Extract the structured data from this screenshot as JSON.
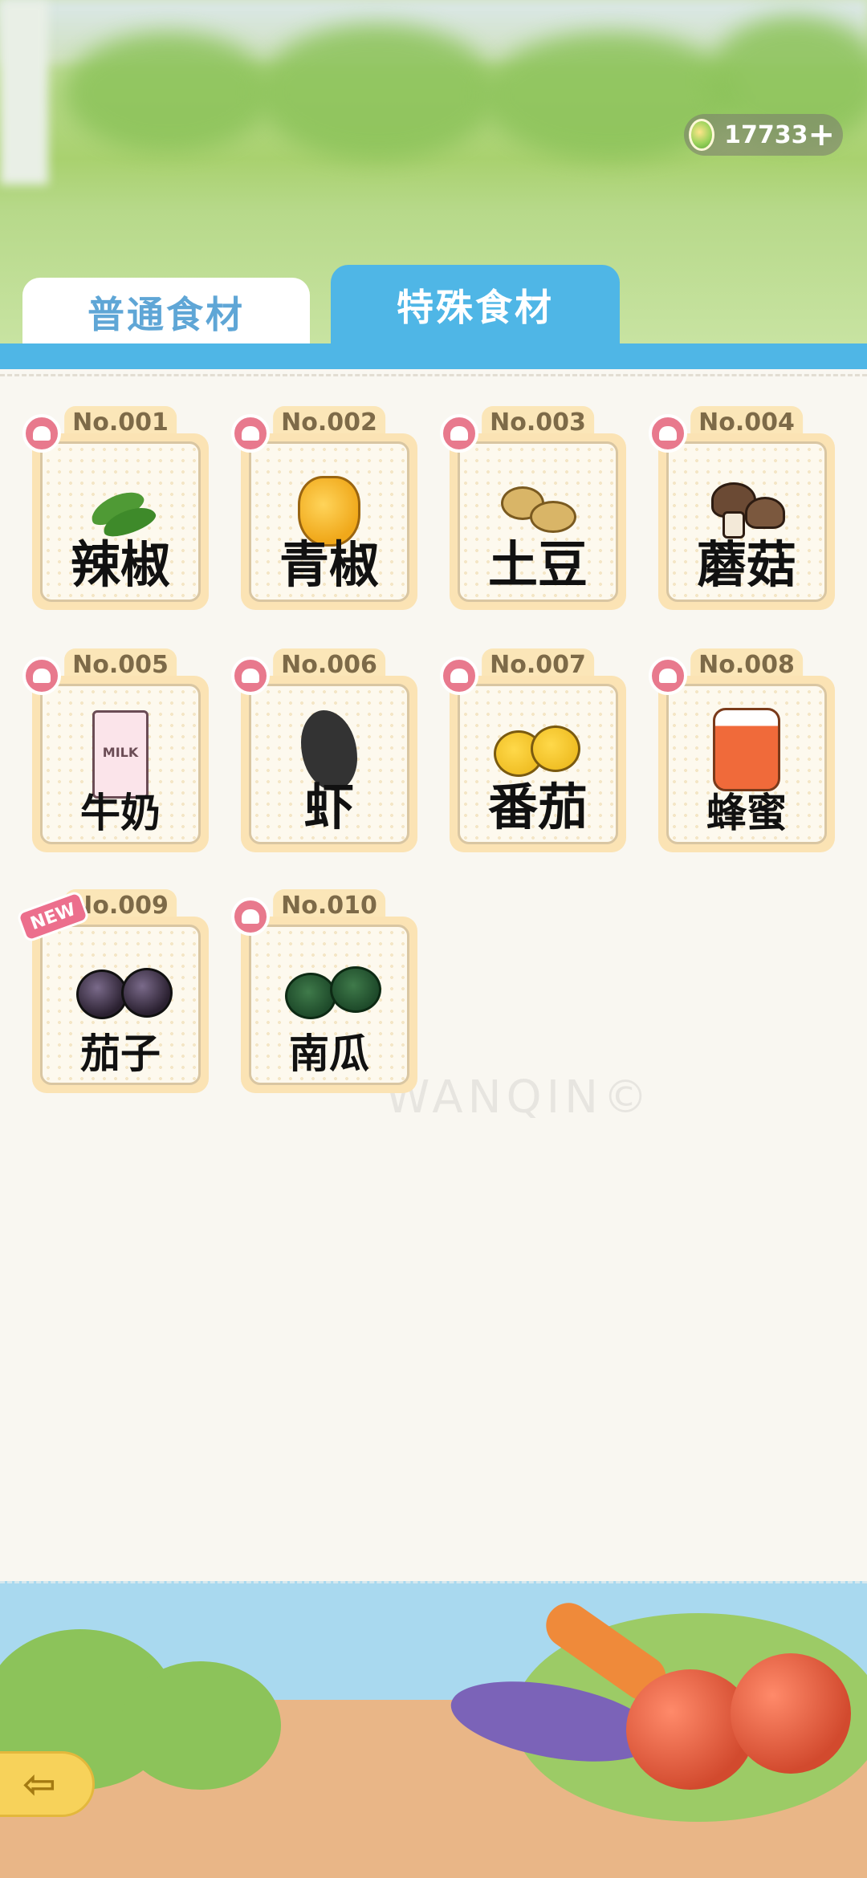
{
  "header": {
    "currency_amount": "17733",
    "currency_plus": "+"
  },
  "tabs": [
    {
      "label": "普通食材",
      "active": false
    },
    {
      "label": "特殊食材",
      "active": true
    }
  ],
  "ingredients": [
    {
      "no": "No.001",
      "name": "辣椒",
      "icon": "chili-pepper-icon"
    },
    {
      "no": "No.002",
      "name": "青椒",
      "icon": "bell-pepper-icon"
    },
    {
      "no": "No.003",
      "name": "土豆",
      "icon": "potato-icon"
    },
    {
      "no": "No.004",
      "name": "蘑菇",
      "icon": "mushroom-icon"
    },
    {
      "no": "No.005",
      "name": "牛奶",
      "icon": "milk-carton-icon",
      "carton_text": "MILK"
    },
    {
      "no": "No.006",
      "name": "虾",
      "icon": "shrimp-icon"
    },
    {
      "no": "No.007",
      "name": "番茄",
      "icon": "tomato-icon"
    },
    {
      "no": "No.008",
      "name": "蜂蜜",
      "icon": "honey-jar-icon"
    },
    {
      "no": "No.009",
      "name": "茄子",
      "icon": "eggplant-icon",
      "badge": "NEW"
    },
    {
      "no": "No.010",
      "name": "南瓜",
      "icon": "pumpkin-icon"
    }
  ],
  "watermark": {
    "text": "WANQIN©"
  },
  "colors": {
    "tab_active": "#4fb6e6",
    "tab_inactive_text": "#5fa6d6",
    "card_frame": "#fbe3b4",
    "chef_badge": "#e8798d",
    "new_badge": "#ec6f8d",
    "back_button": "#f7d25a"
  }
}
